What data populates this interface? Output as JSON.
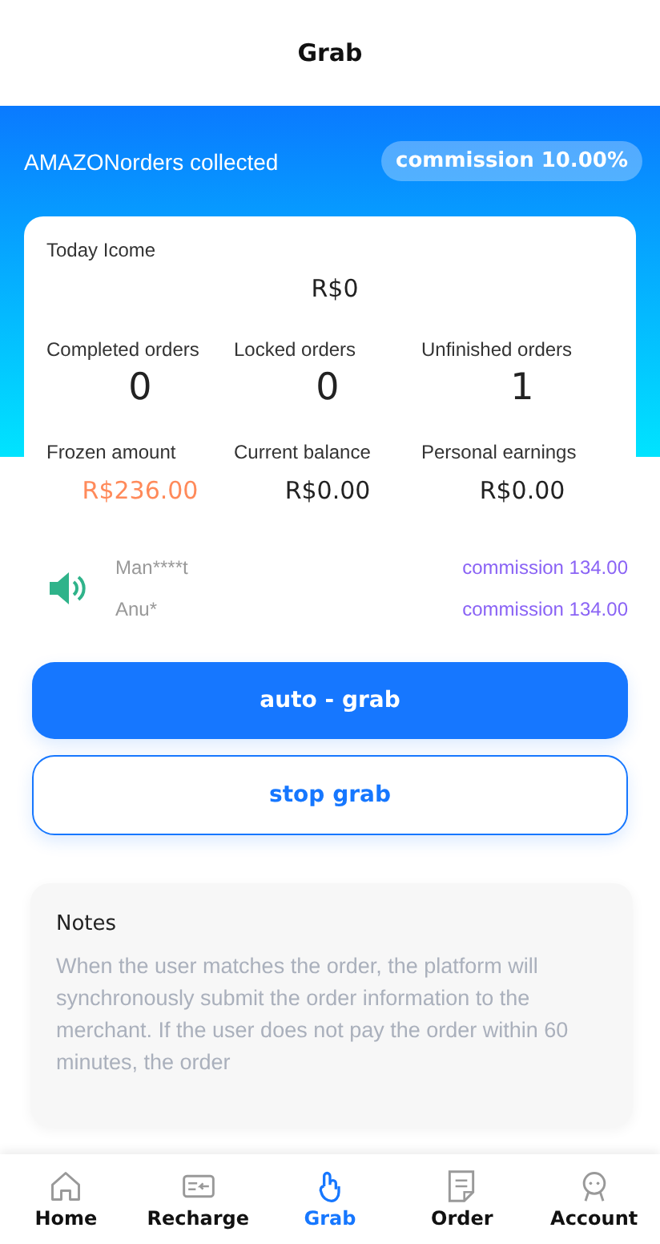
{
  "header": {
    "title": "Grab"
  },
  "banner": {
    "label": "AMAZONorders collected",
    "commission": "commission 10.00%"
  },
  "income": {
    "label": "Today Icome",
    "value": "R$0"
  },
  "stats": [
    {
      "label": "Completed orders",
      "value": "0"
    },
    {
      "label": "Locked orders",
      "value": "0"
    },
    {
      "label": "Unfinished orders",
      "value": "1"
    }
  ],
  "amounts": [
    {
      "label": "Frozen amount",
      "value": "R$236.00",
      "kind": "highlight"
    },
    {
      "label": "Current balance",
      "value": "R$0.00",
      "kind": "plain"
    },
    {
      "label": "Personal earnings",
      "value": "R$0.00",
      "kind": "plain"
    }
  ],
  "ticker": [
    {
      "user": "Man****t",
      "commission": "commission 134.00"
    },
    {
      "user": "Anu*",
      "commission": "commission 134.00"
    }
  ],
  "buttons": [
    {
      "label": "auto - grab",
      "kind": "primary"
    },
    {
      "label": "stop grab",
      "kind": "outline"
    }
  ],
  "notes": {
    "title": "Notes",
    "text": "When the user matches the order, the platform will synchronously submit the order information to the merchant. If the user does not pay the order within 60  minutes, the order"
  },
  "tabbar": [
    {
      "label": "Home",
      "kind": "home",
      "selected": false
    },
    {
      "label": "Recharge",
      "kind": "recharge",
      "selected": false
    },
    {
      "label": "Grab",
      "kind": "grab",
      "selected": true
    },
    {
      "label": "Order",
      "kind": "order",
      "selected": false
    },
    {
      "label": "Account",
      "kind": "account",
      "selected": false
    }
  ]
}
